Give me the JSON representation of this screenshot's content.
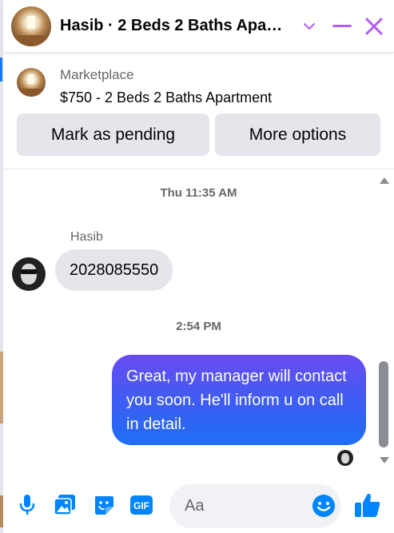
{
  "header": {
    "title": "Hasib · 2 Beds 2 Baths Apa…",
    "icons": [
      "chevron-down-icon",
      "minimize-icon",
      "close-icon"
    ],
    "accent_color": "#b15cf0"
  },
  "marketplace": {
    "label": "Marketplace",
    "listing": "$750 - 2 Beds 2 Baths Apartment",
    "pending_button": "Mark as pending",
    "more_button": "More options"
  },
  "messages": {
    "timestamp_1": "Thu 11:35 AM",
    "sender_name": "Hasib",
    "incoming_text": "2028085550",
    "timestamp_2": "2:54 PM",
    "outgoing_text": "Great, my manager will contact you soon. He'll inform u on call in detail."
  },
  "composer": {
    "placeholder": "Aa",
    "icons": [
      "microphone-icon",
      "photo-icon",
      "sticker-icon",
      "gif-icon",
      "emoji-icon",
      "thumbs-up-icon"
    ],
    "gif_label": "GIF",
    "accent_color": "#0084ff"
  },
  "colors": {
    "bubble_gradient_top": "#6a4bf2",
    "bubble_gradient_bottom": "#1f6ff5",
    "incoming_bubble": "#e4e6eb"
  }
}
